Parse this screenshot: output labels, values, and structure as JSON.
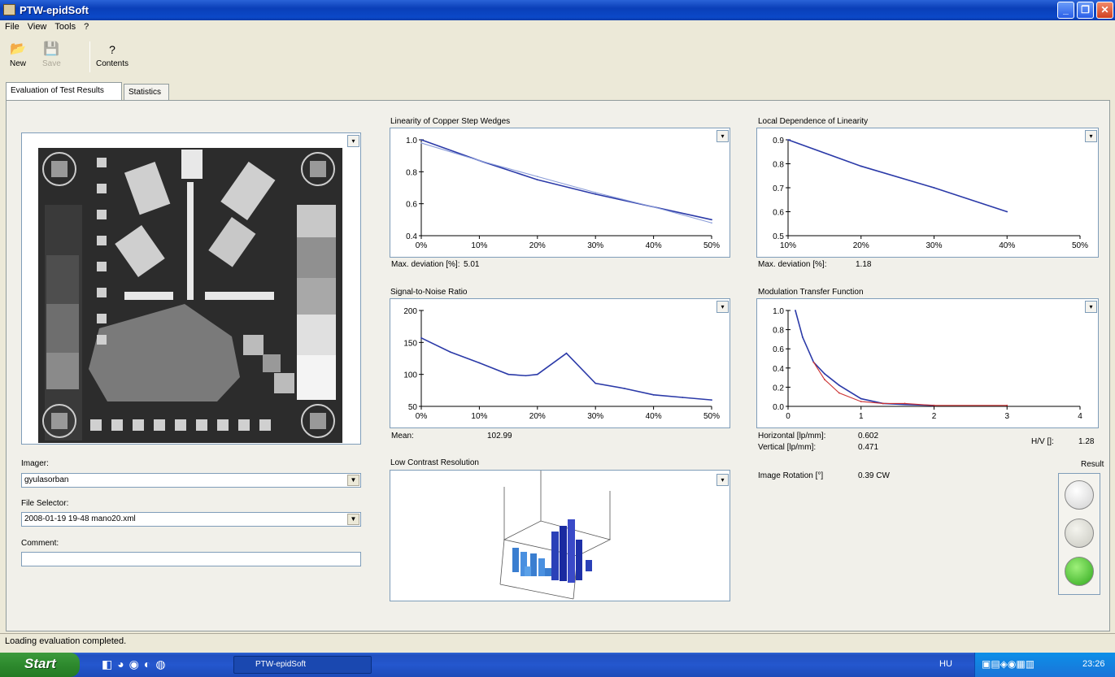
{
  "window": {
    "title": "PTW-epidSoft"
  },
  "menu": [
    "File",
    "View",
    "Tools",
    "?"
  ],
  "toolbar": {
    "new_label": "New",
    "save_label": "Save",
    "contents_label": "Contents"
  },
  "tabs": [
    {
      "label": "Evaluation of Test Results",
      "active": true
    },
    {
      "label": "Statistics",
      "active": false
    }
  ],
  "left": {
    "imager_label": "Imager:",
    "imager_value": "gyulasorban",
    "file_selector_label": "File Selector:",
    "file_selector_value": "2008-01-19 19-48 mano20.xml",
    "comment_label": "Comment:",
    "comment_value": ""
  },
  "charts": {
    "linearity": {
      "title": "Linearity of Copper Step Wedges",
      "footer_label": "Max. deviation [%]:",
      "footer_value": "5.01"
    },
    "local": {
      "title": "Local Dependence of Linearity",
      "footer_label": "Max. deviation [%]:",
      "footer_value": "1.18"
    },
    "snr": {
      "title": "Signal-to-Noise Ratio",
      "footer_label": "Mean:",
      "footer_value": "102.99"
    },
    "mtf": {
      "title": "Modulation Transfer Function"
    },
    "lcr": {
      "title": "Low Contrast Resolution"
    }
  },
  "mtf_results": {
    "horizontal_label": "Horizontal [lp/mm]:",
    "horizontal_value": "0.602",
    "vertical_label": "Vertical [lp/mm]:",
    "vertical_value": "0.471",
    "hv_label": "H/V []:",
    "hv_value": "1.28",
    "rotation_label": "Image Rotation [°]",
    "rotation_value": "0.39 CW",
    "result_label": "Result"
  },
  "result_lamps": [
    {
      "color": "#dddddd"
    },
    {
      "color": "#d8d8d0"
    },
    {
      "color": "#3cb82a"
    }
  ],
  "status": {
    "text": "Loading evaluation completed."
  },
  "taskbar": {
    "start_label": "Start",
    "app_label": "PTW-epidSoft",
    "lang": "HU",
    "clock": "23:26"
  },
  "chart_data": [
    {
      "type": "line",
      "title": "Linearity of Copper Step Wedges",
      "x": [
        0,
        10,
        20,
        30,
        40,
        50
      ],
      "xticks": [
        "0%",
        "10%",
        "20%",
        "30%",
        "40%",
        "50%"
      ],
      "ylim": [
        0.4,
        1.0
      ],
      "yticks": [
        "0.4",
        "0.6",
        "0.8",
        "1.0"
      ],
      "xlim": [
        0,
        50
      ],
      "series": [
        {
          "color": "#2b3aa8",
          "values": [
            1.0,
            0.87,
            0.75,
            0.66,
            0.58,
            0.5
          ]
        },
        {
          "color": "#8a9cd8",
          "values": [
            0.98,
            0.87,
            0.77,
            0.67,
            0.58,
            0.48
          ]
        }
      ]
    },
    {
      "type": "line",
      "title": "Local Dependence of Linearity",
      "x": [
        10,
        20,
        30,
        40
      ],
      "xticks": [
        "10%",
        "20%",
        "30%",
        "40%",
        "50%"
      ],
      "xlim": [
        10,
        50
      ],
      "ylim": [
        0.5,
        0.9
      ],
      "yticks": [
        "0.5",
        "0.6",
        "0.7",
        "0.8",
        "0.9"
      ],
      "series": [
        {
          "color": "#2b3aa8",
          "values": [
            0.9,
            0.79,
            0.7,
            0.6
          ]
        }
      ]
    },
    {
      "type": "line",
      "title": "Signal-to-Noise Ratio",
      "x": [
        0,
        5,
        10,
        15,
        18,
        20,
        25,
        30,
        35,
        40,
        45,
        50
      ],
      "xticks": [
        "0%",
        "10%",
        "20%",
        "30%",
        "40%",
        "50%"
      ],
      "xlim": [
        0,
        50
      ],
      "ylim": [
        50,
        200
      ],
      "yticks": [
        "50",
        "100",
        "150",
        "200"
      ],
      "series": [
        {
          "color": "#2b3aa8",
          "values": [
            157,
            135,
            118,
            100,
            98,
            100,
            133,
            86,
            78,
            68,
            64,
            60
          ]
        }
      ]
    },
    {
      "type": "line",
      "title": "Modulation Transfer Function",
      "xlim": [
        0,
        4
      ],
      "ylim": [
        0,
        1.0
      ],
      "xticks": [
        "0",
        "1",
        "2",
        "3",
        "4"
      ],
      "yticks": [
        "0.0",
        "0.2",
        "0.4",
        "0.6",
        "0.8",
        "1.0"
      ],
      "series": [
        {
          "color": "#2b3aa8",
          "x": [
            0.1,
            0.2,
            0.35,
            0.5,
            0.7,
            1.0,
            1.3,
            1.6,
            2.0
          ],
          "values": [
            1.0,
            0.72,
            0.46,
            0.34,
            0.22,
            0.08,
            0.03,
            0.02,
            0.01
          ]
        },
        {
          "color": "#cc3333",
          "x": [
            0.35,
            0.5,
            0.7,
            1.0,
            1.3,
            1.6,
            2.0,
            3.0
          ],
          "values": [
            0.46,
            0.28,
            0.14,
            0.05,
            0.03,
            0.03,
            0.01,
            0.01
          ]
        }
      ]
    }
  ]
}
